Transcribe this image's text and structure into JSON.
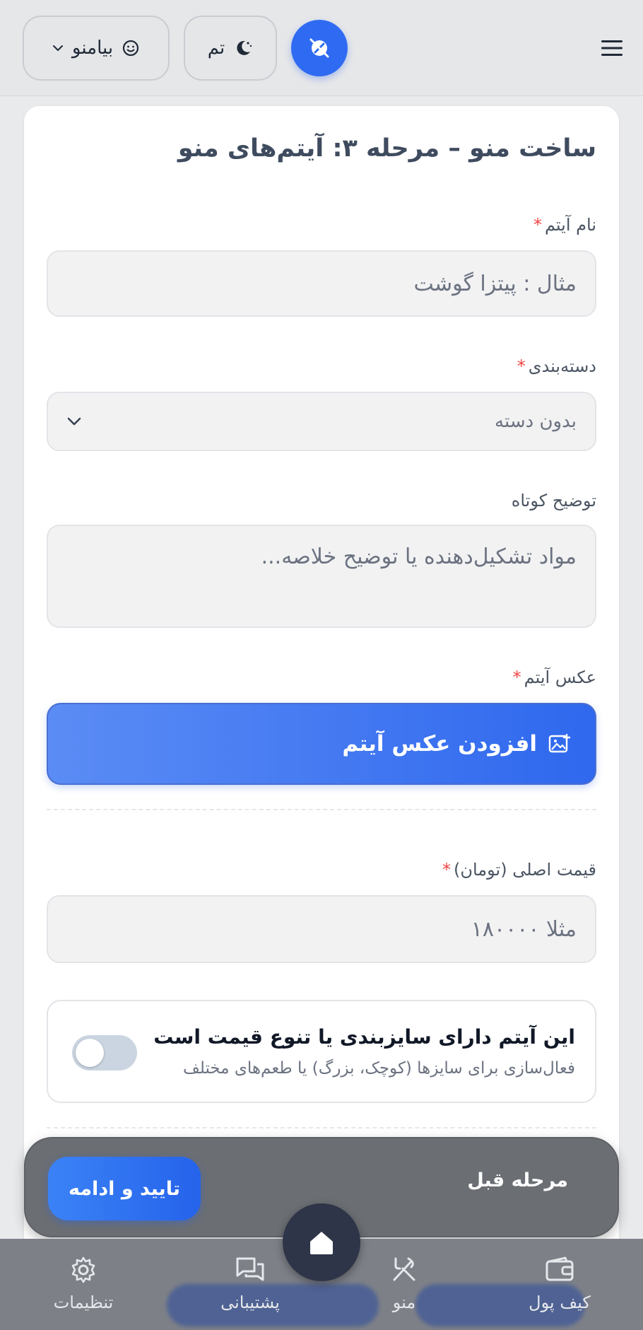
{
  "header": {
    "theme_label": "تم",
    "lang_label": "بیامنو"
  },
  "page": {
    "title": "ساخت منو – مرحله ۳: آیتم‌های منو"
  },
  "form": {
    "item_name": {
      "label": "نام آیتم",
      "required_mark": "*",
      "placeholder": "مثال : پیتزا گوشت"
    },
    "category": {
      "label": "دسته‌بندی",
      "required_mark": "*",
      "value": "بدون دسته"
    },
    "description": {
      "label": "توضیح کوتاه",
      "placeholder": "مواد تشکیل‌دهنده یا توضیح خلاصه..."
    },
    "image": {
      "label": "عکس آیتم",
      "required_mark": "*",
      "button_label": "افزودن عکس آیتم"
    },
    "price": {
      "label": "قیمت اصلی (تومان)",
      "required_mark": "*",
      "placeholder": "مثلا ۱۸۰۰۰۰"
    },
    "variants_toggle": {
      "title": "این آیتم دارای سایزبندی یا تنوع قیمت است",
      "subtitle": "فعال‌سازی برای سایزها (کوچک، بزرگ) یا طعم‌های مختلف",
      "enabled": false
    }
  },
  "actions": {
    "prev_label": "مرحله قبل",
    "confirm_label": "تایید و ادامه"
  },
  "bottom_nav": {
    "wallet": "کیف پول",
    "menu": "منو",
    "support": "پشتیبانی",
    "settings": "تنظیمات"
  },
  "colors": {
    "primary": "#2f6bf2",
    "required": "#ef4444",
    "nav_background": "#7d8087",
    "action_bar": "#6b6e73"
  }
}
